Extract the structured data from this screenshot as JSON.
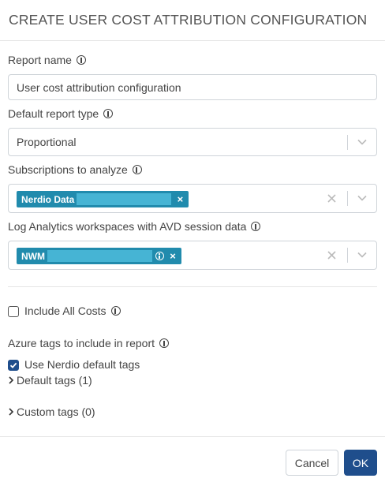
{
  "dialog": {
    "title": "CREATE USER COST ATTRIBUTION CONFIGURATION"
  },
  "report_name": {
    "label": "Report name",
    "value": "User cost attribution configuration"
  },
  "report_type": {
    "label": "Default report type",
    "value": "Proportional"
  },
  "subscriptions": {
    "label": "Subscriptions to analyze",
    "tag_label": "Nerdio Data"
  },
  "workspaces": {
    "label": "Log Analytics workspaces with AVD session data",
    "tag_label": "NWM"
  },
  "include_all_costs": {
    "label": "Include All Costs",
    "checked": false
  },
  "azure_tags": {
    "label": "Azure tags to include in report",
    "use_default_label": "Use Nerdio default tags",
    "use_default_checked": true,
    "default_tags_label": "Default tags (1)",
    "custom_tags_label": "Custom tags (0)"
  },
  "footer": {
    "cancel_label": "Cancel",
    "ok_label": "OK"
  },
  "colors": {
    "tag_bg": "#218bad",
    "primary": "#1f4e8c",
    "border": "#cfd4d9"
  },
  "icons": [
    "info-icon",
    "chevron-down-icon",
    "clear-icon",
    "close-icon",
    "check-icon",
    "caret-right-icon"
  ]
}
